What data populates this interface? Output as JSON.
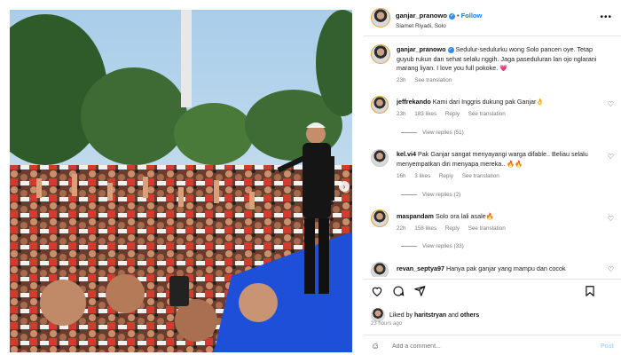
{
  "post": {
    "username": "ganjar_pranowo",
    "follow_label": "Follow",
    "location": "Slamet Riyadi, Solo",
    "more_label": "•••"
  },
  "caption": {
    "username": "ganjar_pranowo",
    "text": "Sedulur-sedulurku wong Solo pancen oye. Tetap guyub rukun dan sehat selalu nggih. Jaga paseduluran lan ojo nglarani marang liyan. I love you full pokoke. 💗",
    "age": "23h",
    "see_translation": "See translation"
  },
  "comments": [
    {
      "username": "jeffrekando",
      "text": "Kami dari Inggris dukung pak Ganjar👌",
      "age": "23h",
      "likes": "183 likes",
      "reply": "Reply",
      "see_translation": "See translation",
      "view_replies": "View replies (51)"
    },
    {
      "username": "kel.vi4",
      "text": "Pak Ganjar sangat menyayangi warga difable.. Beliau selalu menyempatkan diri menyapa mereka.. 🔥🔥",
      "age": "16h",
      "likes": "3 likes",
      "reply": "Reply",
      "see_translation": "See translation",
      "view_replies": "View replies (2)"
    },
    {
      "username": "maspandam",
      "text": "Solo ora lali asale🔥",
      "age": "22h",
      "likes": "158 likes",
      "reply": "Reply",
      "see_translation": "See translation",
      "view_replies": "View replies (33)"
    },
    {
      "username": "revan_septya97",
      "text": "Hanya pak ganjar yang mampu dan cocok"
    }
  ],
  "engagement": {
    "liked_prefix": "Liked by",
    "liked_user": "haritstryan",
    "liked_and": "and",
    "liked_others": "others",
    "time_ago": "23 hours ago"
  },
  "composer": {
    "placeholder": "Add a comment...",
    "post_label": "Post"
  },
  "colors": {
    "accent": "#0a84f7",
    "verified": "#2b8cf3",
    "muted": "#777777"
  },
  "icons": [
    "heart-icon",
    "comment-icon",
    "share-icon",
    "bookmark-icon",
    "emoji-icon",
    "verified-icon",
    "chevron-right-icon"
  ]
}
